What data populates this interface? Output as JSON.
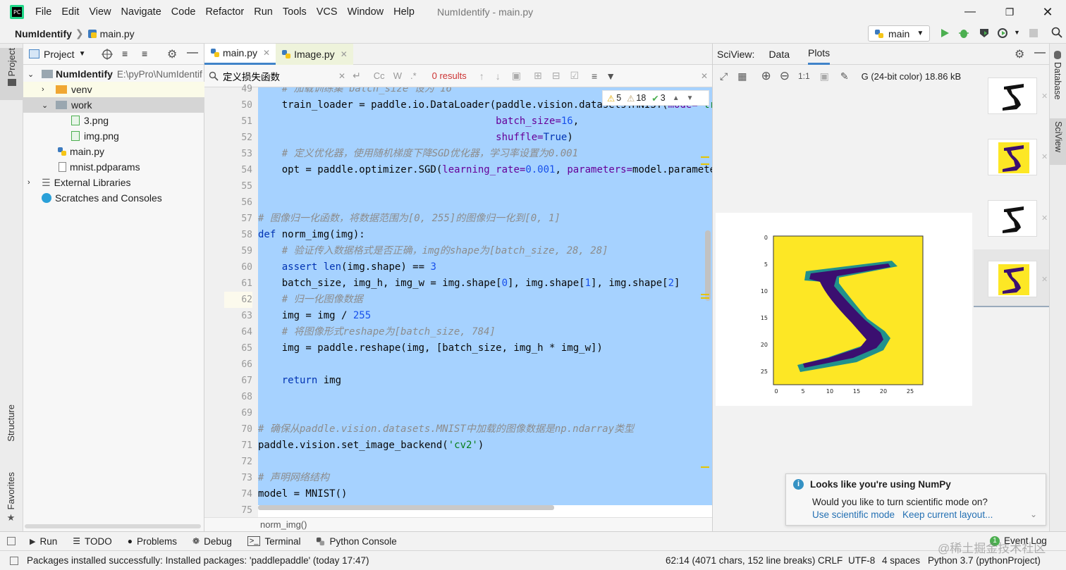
{
  "menubar": {
    "items": [
      "File",
      "Edit",
      "View",
      "Navigate",
      "Code",
      "Refactor",
      "Run",
      "Tools",
      "VCS",
      "Window",
      "Help"
    ],
    "window_title": "NumIdentify - main.py"
  },
  "navbar": {
    "project": "NumIdentify",
    "file": "main.py",
    "run_config": "main"
  },
  "left_strip": {
    "project": "Project",
    "structure": "Structure",
    "favorites": "Favorites"
  },
  "project_panel": {
    "title": "Project",
    "tree": [
      {
        "label": "NumIdentify",
        "extra": "E:\\pyPro\\NumIdentif",
        "icon": "folder-icon"
      },
      {
        "label": "venv",
        "icon": "folder-icon"
      },
      {
        "label": "work",
        "icon": "folder-icon"
      },
      {
        "label": "3.png",
        "icon": "image-file-icon"
      },
      {
        "label": "img.png",
        "icon": "image-file-icon"
      },
      {
        "label": "main.py",
        "icon": "python-file-icon"
      },
      {
        "label": "mnist.pdparams",
        "icon": "file-icon"
      },
      {
        "label": "External Libraries",
        "icon": "library-icon"
      },
      {
        "label": "Scratches and Consoles",
        "icon": "scratch-icon"
      }
    ]
  },
  "editor": {
    "tabs": [
      {
        "label": "main.py",
        "active": true
      },
      {
        "label": "Image.py",
        "active": false
      }
    ],
    "find": {
      "query": "定义损失函数",
      "results": "0 results",
      "case_toggle": "Cc",
      "word_toggle": "W",
      "regex_toggle": ".*"
    },
    "inspections": {
      "warnings": "5",
      "weak_warnings": "18",
      "typos": "3"
    },
    "line_numbers": [
      "49",
      "50",
      "51",
      "52",
      "53",
      "54",
      "55",
      "56",
      "57",
      "58",
      "59",
      "60",
      "61",
      "62",
      "63",
      "64",
      "65",
      "66",
      "67",
      "68",
      "69",
      "70",
      "71",
      "72",
      "73",
      "74",
      "75"
    ],
    "breadcrumb": "norm_img()"
  },
  "sciview": {
    "title": "SciView:",
    "tabs": [
      "Data",
      "Plots"
    ],
    "active_tab": "Plots",
    "image_info": "G (24-bit color) 18.86 kB",
    "zoom_actual": "1:1",
    "plot": {
      "y_ticks": [
        "0",
        "5",
        "10",
        "15",
        "20",
        "25"
      ],
      "x_ticks": [
        "0",
        "5",
        "10",
        "15",
        "20",
        "25"
      ]
    },
    "thumbnails": 4
  },
  "right_strip": {
    "database": "Database",
    "sciview": "SciView"
  },
  "notification": {
    "title": "Looks like you're using NumPy",
    "body": "Would you like to turn scientific mode on?",
    "action1": "Use scientific mode",
    "action2": "Keep current layout..."
  },
  "toolwindows": [
    "Run",
    "TODO",
    "Problems",
    "Debug",
    "Terminal",
    "Python Console"
  ],
  "event_log": {
    "label": "Event Log",
    "count": "1"
  },
  "statusbar": {
    "message": "Packages installed successfully: Installed packages: 'paddlepaddle' (today 17:47)",
    "position": "62:14 (4071 chars, 152 line breaks)",
    "line_sep": "CRLF",
    "encoding": "UTF-8",
    "indent": "4 spaces",
    "interpreter": "Python 3.7 (pythonProject)"
  },
  "watermark": "@稀土掘金技术社区",
  "colors": {
    "selection": "#a6d2ff",
    "accent": "#2470b3",
    "run_green": "#4caf50"
  }
}
